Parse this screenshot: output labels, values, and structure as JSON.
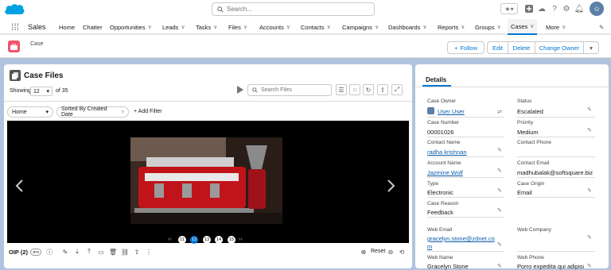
{
  "search": {
    "placeholder": "Search..."
  },
  "nav": {
    "app_name": "Sales",
    "items": [
      "Home",
      "Chatter",
      "Opportunities",
      "Leads",
      "Tasks",
      "Files",
      "Accounts",
      "Contacts",
      "Campaigns",
      "Dashboards",
      "Reports",
      "Groups",
      "Cases",
      "More"
    ],
    "active": "Cases"
  },
  "record": {
    "object_label": "Case"
  },
  "actions": {
    "follow": "Follow",
    "edit": "Edit",
    "delete": "Delete",
    "change_owner": "Change Owner"
  },
  "files": {
    "title": "Case Files",
    "showing_label": "Showing",
    "page_size": "12",
    "of_total": "of 35",
    "search_placeholder": "Search Files",
    "filter_home": "Home",
    "sort_label": "Sorted By Created Date",
    "add_filter": "Add Filter",
    "pages": [
      "11",
      "12",
      "13",
      "14",
      "15"
    ],
    "current_page": "12",
    "footer_label": "OIP (2)",
    "file_type": "JPG",
    "reset": "Reset"
  },
  "details": {
    "tab": "Details",
    "fields": {
      "case_owner_label": "Case Owner",
      "case_owner": "User User",
      "status_label": "Status",
      "status": "Escalated",
      "case_number_label": "Case Number",
      "case_number": "00001026",
      "priority_label": "Priority",
      "priority": "Medium",
      "contact_name_label": "Contact Name",
      "contact_name": "radha krishnan",
      "contact_phone_label": "Contact Phone",
      "contact_phone": "",
      "account_name_label": "Account Name",
      "account_name": "Jazmine Wolf",
      "contact_email_label": "Contact Email",
      "contact_email": "madhubalak@softsquare.biz",
      "type_label": "Type",
      "type": "Electronic",
      "case_origin_label": "Case Origin",
      "case_origin": "Email",
      "case_reason_label": "Case Reason",
      "case_reason": "Feedback",
      "web_email_label": "Web Email",
      "web_email_1": "gracelyn.stone@zdnet.co",
      "web_email_2": "m",
      "web_company_label": "Web Company",
      "web_name_label": "Web Name",
      "web_name": "Gracelyn Stone",
      "web_phone_label": "Web Phone",
      "web_phone": "Porro expedita qui adipisci"
    }
  },
  "colors": {
    "brand": "#0176d3",
    "case_icon": "#f2536d",
    "background": "#b0c4df"
  }
}
